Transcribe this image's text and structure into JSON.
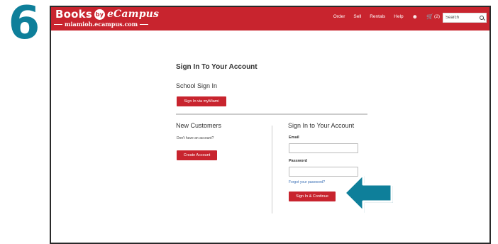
{
  "step": {
    "number": "6"
  },
  "header": {
    "logo_title": "Books",
    "logo_by": "by",
    "logo_brand": "eCampus",
    "logo_sub": "miamioh.ecampus.com",
    "nav": {
      "order": "Order",
      "sell": "Sell",
      "rentals": "Rentals",
      "help": "Help",
      "cart_count": "(2)"
    },
    "search": {
      "placeholder": "Search"
    }
  },
  "signin": {
    "page_title": "Sign In To Your Account",
    "school_section": {
      "title": "School Sign In",
      "button": "Sign In via myMiami"
    },
    "new_customers": {
      "title": "New Customers",
      "text": "Don't have an account?",
      "button": "Create Account"
    },
    "account_section": {
      "title": "Sign In to Your Account",
      "email_label": "Email",
      "password_label": "Password",
      "forgot_link": "Forgot your password?",
      "submit_button": "Sign In & Continue"
    }
  },
  "colors": {
    "brand_red": "#c8242e",
    "accent_teal": "#0e7f9a"
  },
  "icons": {
    "user": "user-icon",
    "cart": "cart-icon",
    "search": "search-icon",
    "arrow": "arrow-left-icon"
  }
}
